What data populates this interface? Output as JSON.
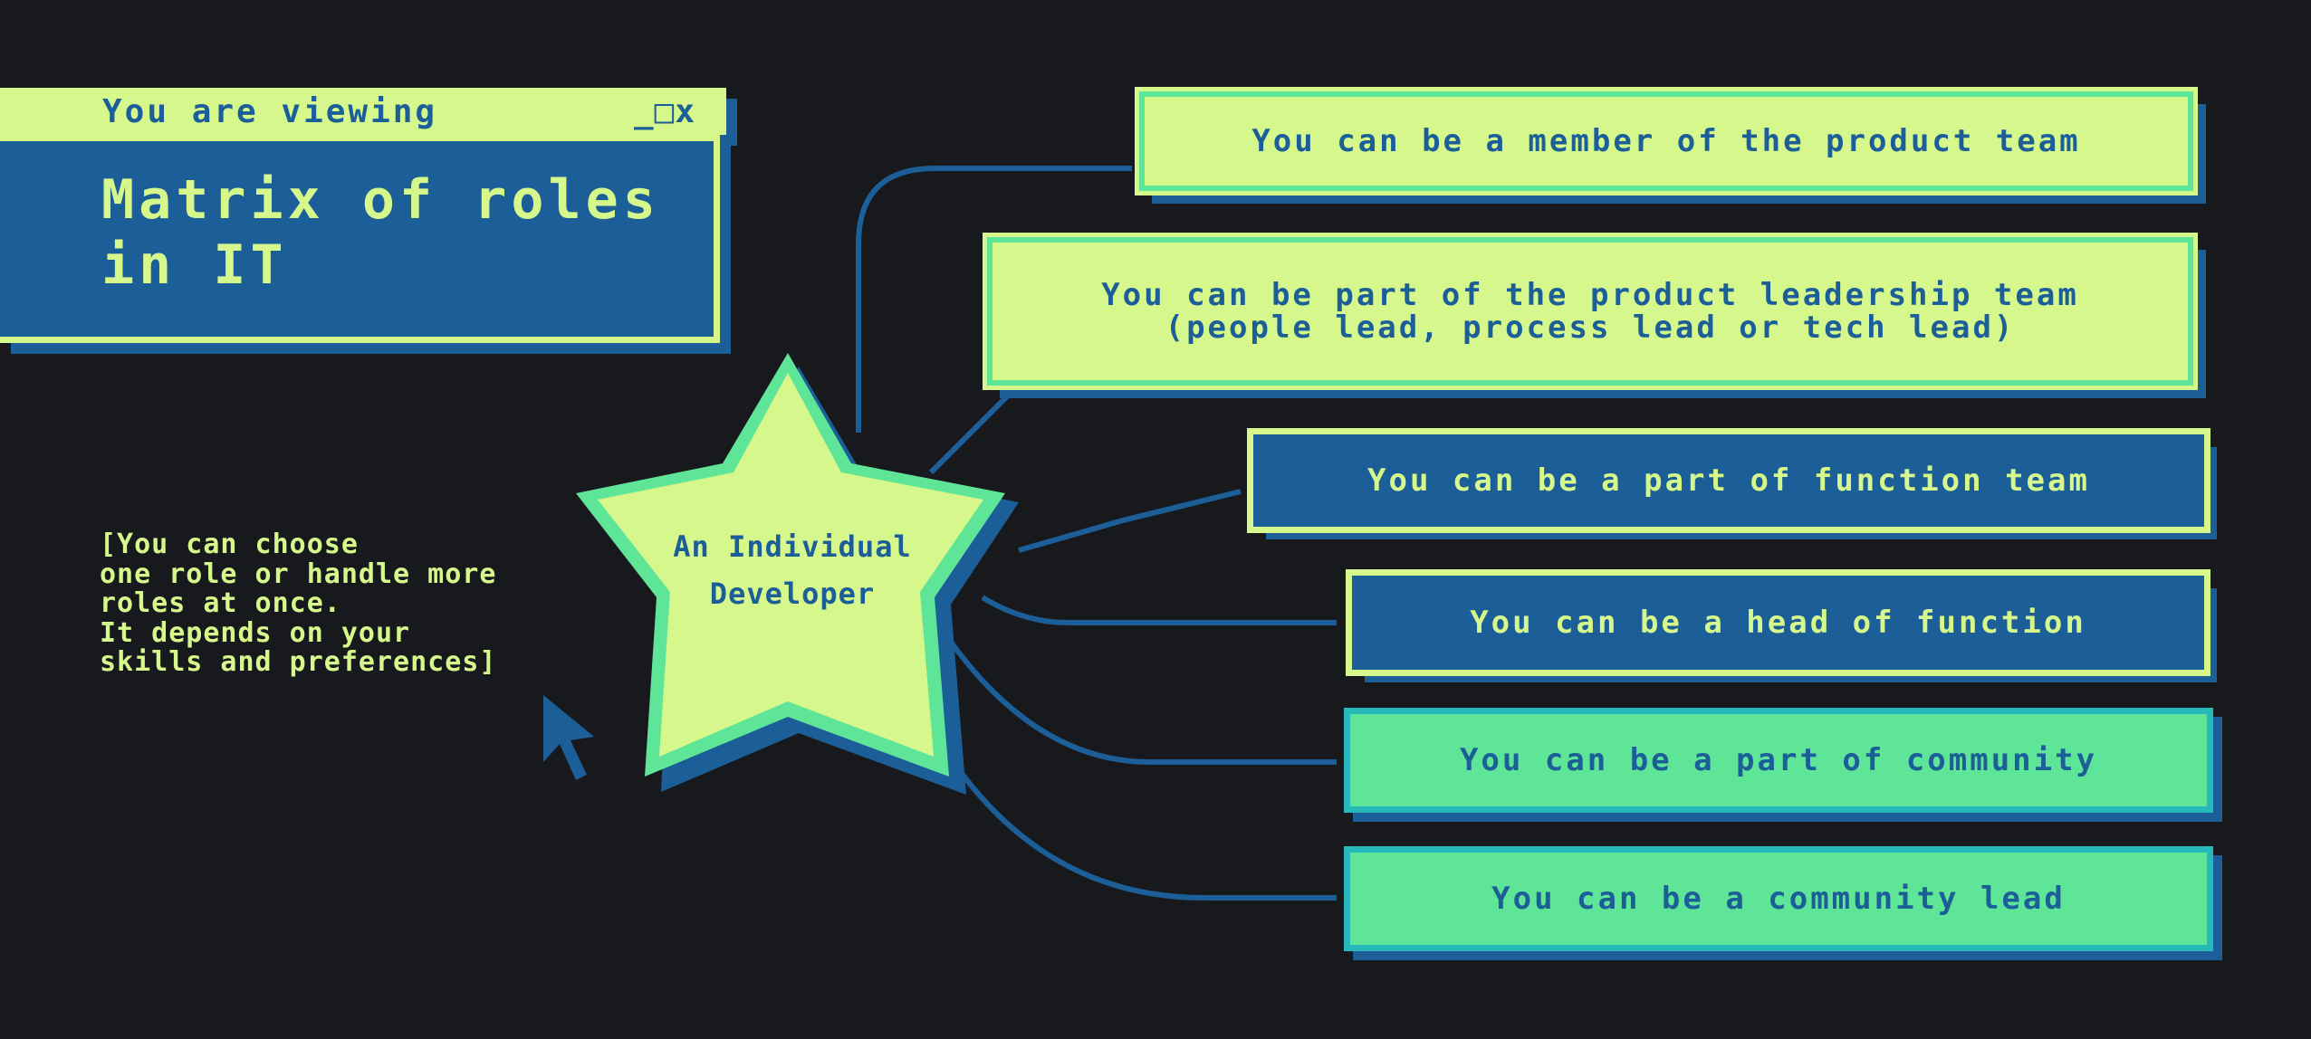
{
  "window": {
    "bar_title": "You are viewing",
    "controls": "_□x",
    "heading_line1": "Matrix of roles",
    "heading_line2": "in IT"
  },
  "note": {
    "text": "[You can choose\none role or handle more\nroles at once.\nIt depends on your\nskills and preferences]"
  },
  "star": {
    "line1": "An Individual",
    "line2": "Developer"
  },
  "roles": [
    {
      "text": "You can be a member of the product team",
      "style": "light"
    },
    {
      "text": "You can be part of the product leadership team\n(people lead, process lead or tech lead)",
      "style": "light"
    },
    {
      "text": "You can be a part of function team",
      "style": "blue"
    },
    {
      "text": "You can be a head of function",
      "style": "blue"
    },
    {
      "text": "You can be a part of community",
      "style": "green"
    },
    {
      "text": "You can be a community lead",
      "style": "green"
    }
  ],
  "colors": {
    "background": "#18191d",
    "lime": "#d6f78b",
    "blue": "#1c5e98",
    "mint": "#5fe597",
    "teal": "#27b9b9"
  },
  "icons": [
    "window-controls-icon",
    "cursor-arrow-icon",
    "star-icon"
  ]
}
